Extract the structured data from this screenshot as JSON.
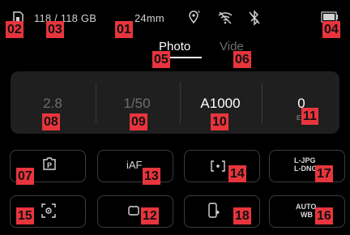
{
  "status_bar": {
    "storage": "118 / 118 GB",
    "focal_length": "24mm",
    "icons": [
      "sd-card-icon",
      "gps-icon",
      "wifi-off-icon",
      "bluetooth-off-icon",
      "battery-icon"
    ]
  },
  "mode_tabs": [
    {
      "label": "Photo",
      "active": true
    },
    {
      "label": "Vide",
      "active": false
    }
  ],
  "exposure": {
    "aperture": "2.8",
    "shutter": "1/50",
    "iso": "A1000",
    "ev": "0",
    "ev_unit": "EV"
  },
  "tiles": {
    "exposure_mode": "P",
    "af_mode": "iAF",
    "metering": "[·]",
    "file_format_top": "L-JPG",
    "file_format_bottom": "L-DNG",
    "face_detect": "face-detect-icon",
    "drive_mode": "single-shot-icon",
    "stabilization": "phone-device-icon",
    "white_balance_top": "AUTO",
    "white_balance_bottom": "WB"
  },
  "annotation_tags": [
    "01",
    "02",
    "03",
    "04",
    "05",
    "06",
    "07",
    "08",
    "09",
    "10",
    "11",
    "12",
    "13",
    "14",
    "15",
    "16",
    "17",
    "18"
  ],
  "colors": {
    "background": "#000000",
    "panel": "#1f1f1f",
    "tag": "#e8353d",
    "active_text": "#ffffff",
    "dim_text": "#6e6e6e"
  }
}
